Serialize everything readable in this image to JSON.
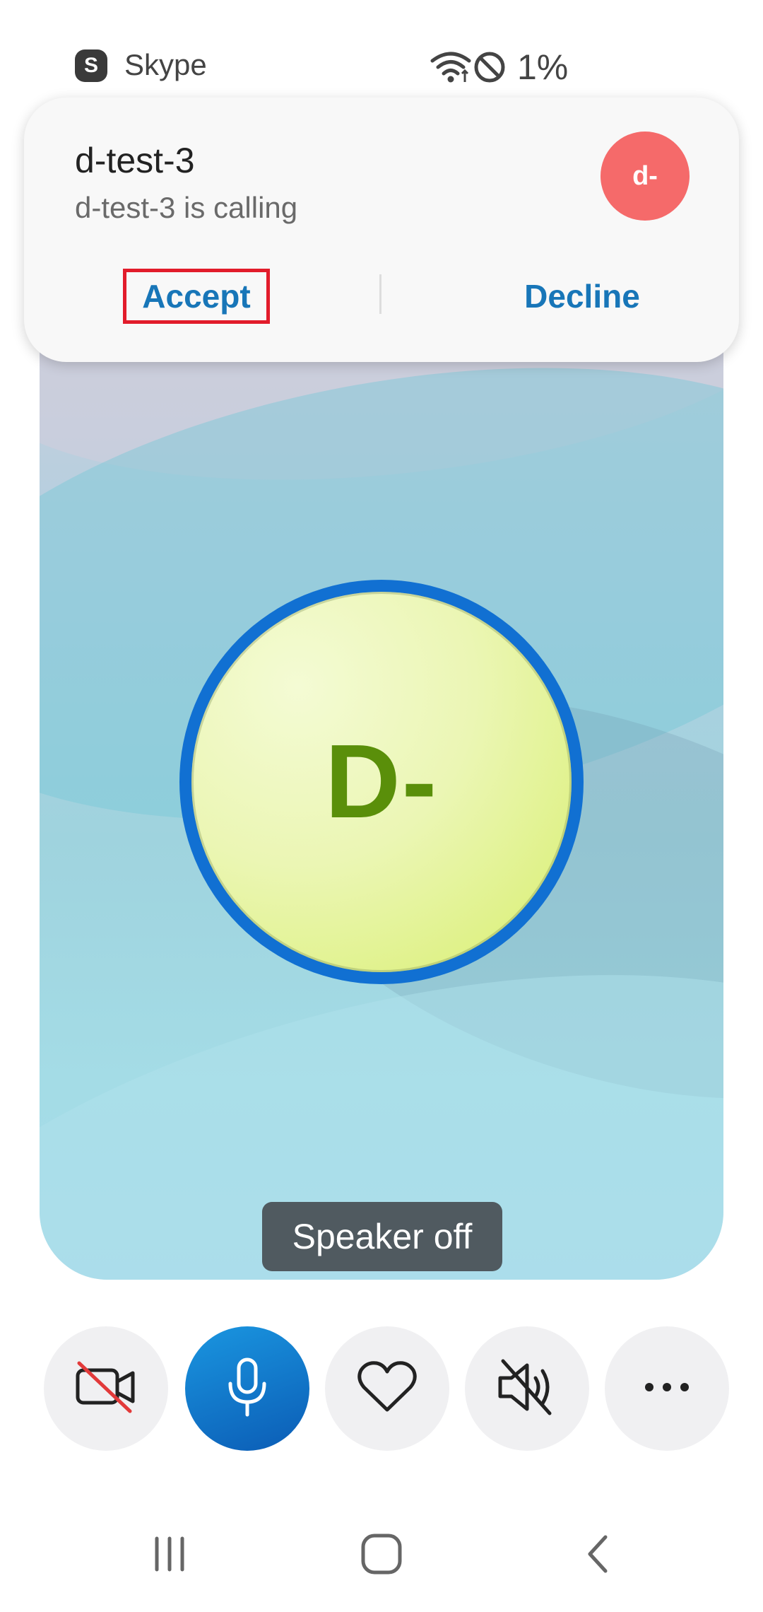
{
  "status_bar": {
    "app_icon_letter": "S",
    "app_name": "Skype",
    "battery": "1%",
    "icons": [
      "wifi-icon",
      "do-not-disturb-icon"
    ]
  },
  "notification": {
    "caller_name": "d-test-3",
    "message": "d-test-3 is calling",
    "avatar_initials": "d-",
    "accept_label": "Accept",
    "decline_label": "Decline",
    "accent_color": "#1876b8",
    "avatar_color": "#f56a6a"
  },
  "call": {
    "avatar_initials": "D-",
    "ring_color": "#1170d2",
    "toast": "Speaker off"
  },
  "controls": [
    {
      "name": "camera-off-button",
      "icon": "video-off-icon"
    },
    {
      "name": "mic-button",
      "icon": "microphone-icon"
    },
    {
      "name": "react-button",
      "icon": "heart-icon"
    },
    {
      "name": "speaker-button",
      "icon": "speaker-muted-icon"
    },
    {
      "name": "more-button",
      "icon": "more-icon"
    }
  ],
  "nav": [
    "recents-icon",
    "home-icon",
    "back-icon"
  ]
}
